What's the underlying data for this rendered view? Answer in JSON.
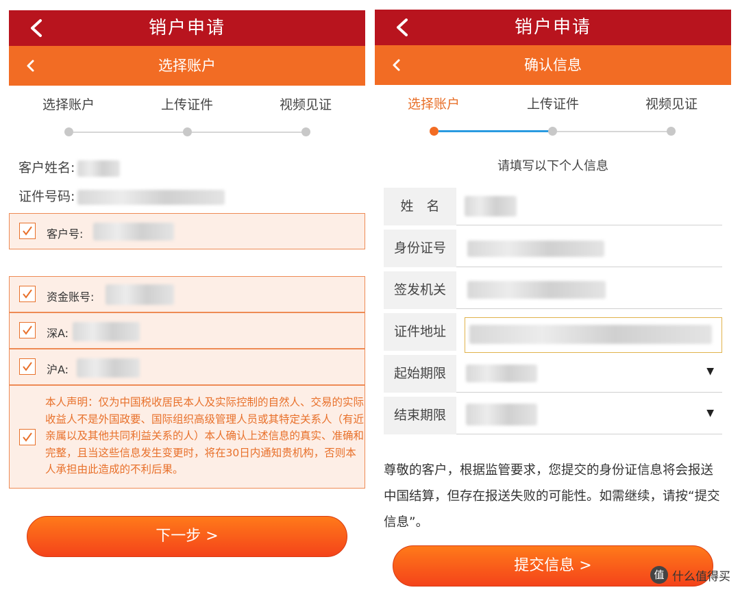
{
  "left": {
    "header": {
      "title": "销户申请"
    },
    "subheader": {
      "title": "选择账户"
    },
    "steps": [
      "选择账户",
      "上传证件",
      "视频见证"
    ],
    "customer_name_label": "客户姓名:",
    "id_number_label": "证件号码:",
    "accounts": {
      "customer_no_label": "客户号:",
      "fund_account_label": "资金账号:",
      "shenzhen_label": "深A:",
      "shanghai_label": "沪A:"
    },
    "declaration": "本人声明：仅为中国税收居民本人及实际控制的自然人、交易的实际收益人不是外国政要、国际组织高级管理人员或其特定关系人（有近亲属以及其他共同利益关系的人）本人确认上述信息的真实、准确和完整，且当这些信息发生变更时，将在30日内通知贵机构，否则本人承担由此造成的不利后果。",
    "next_button": "下一步 >"
  },
  "right": {
    "header": {
      "title": "销户申请"
    },
    "subheader": {
      "title": "确认信息"
    },
    "steps": [
      "选择账户",
      "上传证件",
      "视频见证"
    ],
    "intro": "请填写以下个人信息",
    "fields": {
      "name": "姓　名",
      "id_number": "身份证号",
      "issuing_authority": "签发机关",
      "id_address": "证件地址",
      "start_date": "起始期限",
      "end_date": "结束期限"
    },
    "notice": "尊敬的客户，根据监管要求，您提交的身份证信息将会报送中国结算，但存在报送失败的可能性。如需继续，请按“提交信息”。",
    "submit_button": "提交信息 >"
  },
  "watermark": {
    "icon_text": "值",
    "text": "什么值得买"
  },
  "colors": {
    "header_red": "#b8141e",
    "accent_orange": "#f26c24",
    "progress_blue": "#2a9be0"
  }
}
